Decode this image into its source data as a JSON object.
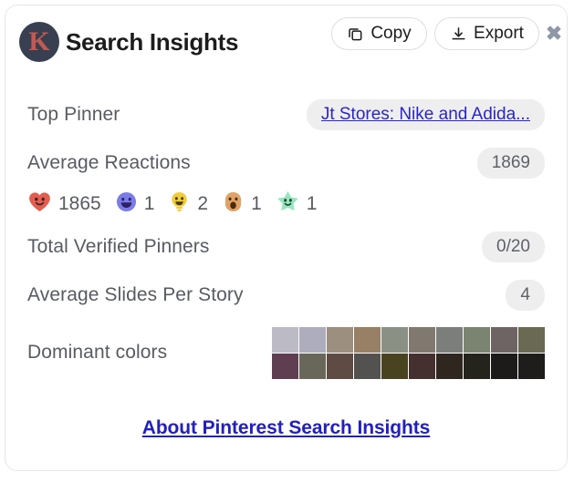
{
  "header": {
    "logo_letter": "K",
    "title": "Search Insights",
    "copy_label": "Copy",
    "export_label": "Export",
    "copy_icon": "copy-icon",
    "export_icon": "download-icon",
    "close_icon": "close-icon"
  },
  "rows": {
    "top_pinner": {
      "label": "Top Pinner",
      "value": "Jt Stores: Nike and Adida..."
    },
    "average_reactions": {
      "label": "Average Reactions",
      "value": "1869"
    },
    "total_verified_pinners": {
      "label": "Total Verified Pinners",
      "value": "0/20"
    },
    "average_slides_per_story": {
      "label": "Average Slides Per Story",
      "value": "4"
    },
    "dominant_colors": {
      "label": "Dominant colors"
    }
  },
  "reactions": [
    {
      "name": "heart-reaction-icon",
      "count": "1865",
      "color": "#e35d4f"
    },
    {
      "name": "laugh-reaction-icon",
      "count": "1",
      "color": "#7c7ce8"
    },
    {
      "name": "lightbulb-reaction-icon",
      "count": "2",
      "color": "#f0cd3a"
    },
    {
      "name": "wow-reaction-icon",
      "count": "1",
      "color": "#e0a366"
    },
    {
      "name": "star-reaction-icon",
      "count": "1",
      "color": "#97e5bd"
    }
  ],
  "dominant_color_swatches": [
    "#bcbac4",
    "#adadbd",
    "#9c8f7f",
    "#978065",
    "#8b9085",
    "#817870",
    "#7c7e7c",
    "#7b8470",
    "#6e6464",
    "#6a6a52",
    "#603e51",
    "#68675a",
    "#5d4b44",
    "#545250",
    "#4a431f",
    "#44302f",
    "#2f2620",
    "#24241c",
    "#1c1b1a",
    "#1e1d1c"
  ],
  "footer": {
    "link_label": "About Pinterest Search Insights"
  }
}
